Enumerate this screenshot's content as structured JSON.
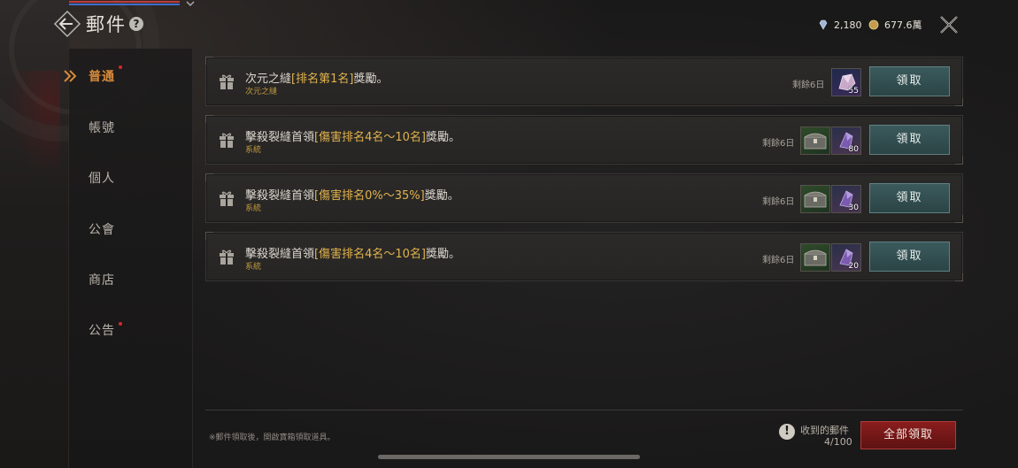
{
  "header": {
    "title": "郵件",
    "help_label": "?",
    "currency_gem": "2,180",
    "currency_gold": "677.6萬"
  },
  "sidebar": {
    "items": [
      {
        "label": "普通"
      },
      {
        "label": "帳號"
      },
      {
        "label": "個人"
      },
      {
        "label": "公會"
      },
      {
        "label": "商店"
      },
      {
        "label": "公告"
      }
    ]
  },
  "mails": [
    {
      "title_prefix": "次元之縫",
      "title_highlight": "[排名第1名]",
      "title_suffix": "獎勵。",
      "sender": "次元之縫",
      "remaining": "剩餘6日",
      "items": [
        {
          "icon": "crystal-ore-icon",
          "qty": "55"
        }
      ],
      "claim_label": "領取"
    },
    {
      "title_prefix": "擊殺裂縫首領",
      "title_highlight": "[傷害排名4名～10名]",
      "title_suffix": "獎勵。",
      "sender": "系統",
      "remaining": "剩餘6日",
      "items": [
        {
          "icon": "treasure-chest-icon",
          "qty": ""
        },
        {
          "icon": "purple-gem-icon",
          "qty": "80"
        }
      ],
      "claim_label": "領取"
    },
    {
      "title_prefix": "擊殺裂縫首領",
      "title_highlight": "[傷害排名0%～35%]",
      "title_suffix": "獎勵。",
      "sender": "系統",
      "remaining": "剩餘6日",
      "items": [
        {
          "icon": "treasure-chest-icon",
          "qty": ""
        },
        {
          "icon": "purple-gem-icon",
          "qty": "30"
        }
      ],
      "claim_label": "領取"
    },
    {
      "title_prefix": "擊殺裂縫首領",
      "title_highlight": "[傷害排名4名～10名]",
      "title_suffix": "獎勵。",
      "sender": "系統",
      "remaining": "剩餘6日",
      "items": [
        {
          "icon": "treasure-chest-icon",
          "qty": ""
        },
        {
          "icon": "purple-gem-icon",
          "qty": "20"
        }
      ],
      "claim_label": "領取"
    }
  ],
  "footer": {
    "note": "※郵件領取後，開啟寶箱領取道具。",
    "received_label": "收到的郵件",
    "received_count": "4/100",
    "claim_all_label": "全部領取"
  },
  "colors": {
    "accent_orange": "#d88a3a",
    "highlight_gold": "#e2b34c",
    "claim_teal": "#3b5a5c",
    "claim_all_red": "#8a1d1d",
    "notify_dot": "#d42a2a"
  }
}
